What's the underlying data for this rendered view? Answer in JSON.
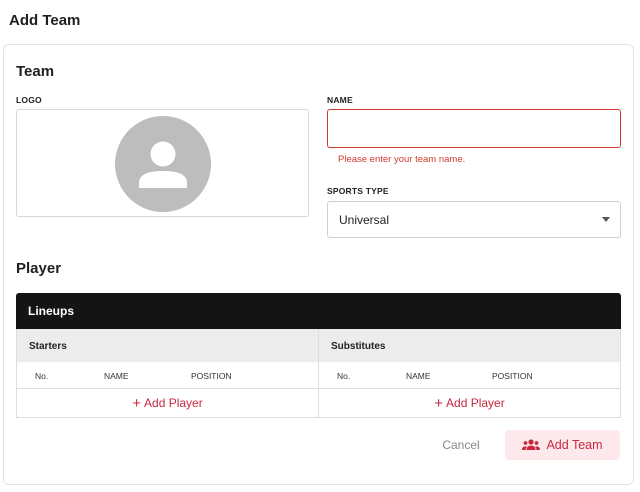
{
  "page": {
    "title": "Add Team"
  },
  "team_section": {
    "title": "Team",
    "logo_label": "LOGO",
    "name_label": "NAME",
    "name_value": "",
    "name_error": "Please enter your team name.",
    "sports_type_label": "SPORTS TYPE",
    "sports_type_value": "Universal"
  },
  "player_section": {
    "title": "Player",
    "lineups_title": "Lineups",
    "starters": {
      "title": "Starters",
      "columns": [
        "No.",
        "NAME",
        "POSITION"
      ],
      "add_label": "Add Player"
    },
    "substitutes": {
      "title": "Substitutes",
      "columns": [
        "No.",
        "NAME",
        "POSITION"
      ],
      "add_label": "Add Player"
    }
  },
  "actions": {
    "cancel_label": "Cancel",
    "add_team_label": "Add Team"
  },
  "colors": {
    "accent": "#c8283f",
    "error": "#d33a2f",
    "header_bar": "#141414",
    "accent_bg": "#fde8ec"
  },
  "icons": {
    "avatar": "person-placeholder-icon",
    "dropdown": "caret-down-icon",
    "add": "plus-icon",
    "add_team": "group-add-icon"
  }
}
